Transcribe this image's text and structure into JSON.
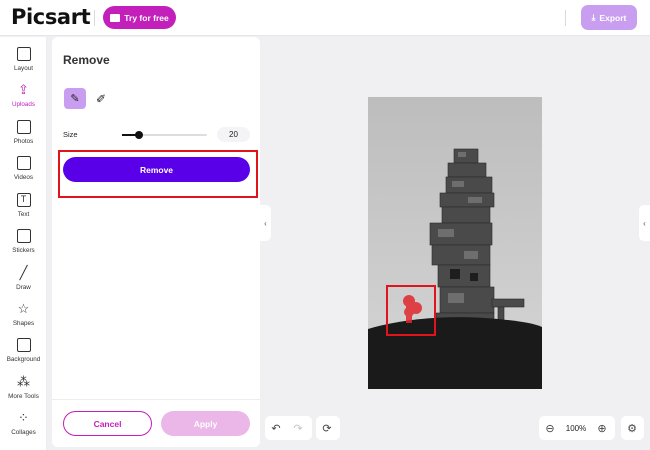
{
  "header": {
    "logo_text": "Picsart",
    "try_label": "Try for free",
    "export_label": "Export"
  },
  "rail": {
    "items": [
      {
        "label": "Layout",
        "icon": "layout-icon"
      },
      {
        "label": "Uploads",
        "icon": "upload-icon",
        "active": true
      },
      {
        "label": "Photos",
        "icon": "photos-icon"
      },
      {
        "label": "Videos",
        "icon": "videos-icon"
      },
      {
        "label": "Text",
        "icon": "text-icon"
      },
      {
        "label": "Stickers",
        "icon": "sticker-icon"
      },
      {
        "label": "Draw",
        "icon": "brush-icon"
      },
      {
        "label": "Shapes",
        "icon": "star-icon"
      },
      {
        "label": "Background",
        "icon": "background-icon"
      },
      {
        "label": "More Tools",
        "icon": "more-tools-icon"
      },
      {
        "label": "Collages",
        "icon": "collages-icon"
      }
    ]
  },
  "panel": {
    "title": "Remove",
    "size_label": "Size",
    "size_value": "20",
    "size_fraction": 0.2,
    "remove_label": "Remove",
    "cancel_label": "Cancel",
    "apply_label": "Apply"
  },
  "toolbar": {
    "zoom": "100%"
  },
  "colors": {
    "brand": "#c31fbb",
    "primary": "#5a00e8",
    "highlight": "#e0141a",
    "accent_light": "#c99ef0"
  }
}
